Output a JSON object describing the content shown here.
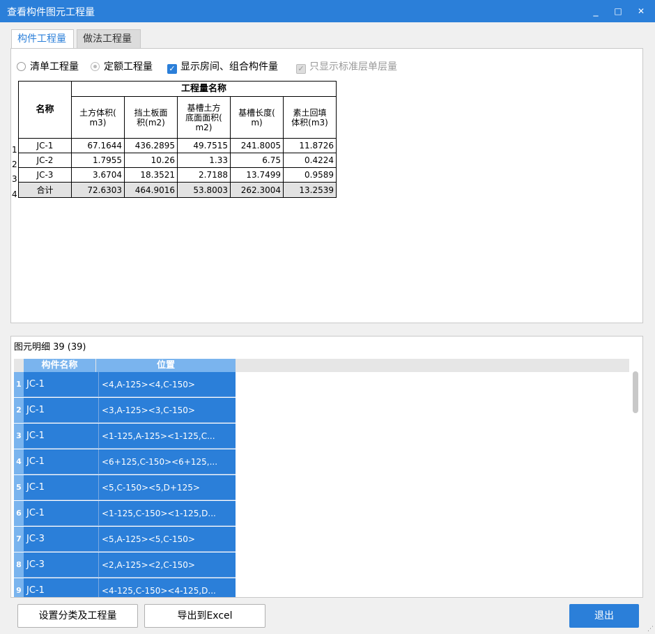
{
  "window": {
    "title": "查看构件图元工程量",
    "minimize": "_",
    "maximize": "□",
    "close": "✕"
  },
  "tabs": [
    {
      "label": "构件工程量"
    },
    {
      "label": "做法工程量"
    }
  ],
  "options": {
    "qingdan": "清单工程量",
    "dinge": "定额工程量",
    "show_rooms": "显示房间、组合构件量",
    "standard_floor": "只显示标准层单层量"
  },
  "quantity_table": {
    "group_header": "工程量名称",
    "name_header": "名称",
    "columns": [
      "土方体积(m3)",
      "挡土板面积(m2)",
      "基槽土方底面面积(m2)",
      "基槽长度(m)",
      "素土回填体积(m3)"
    ],
    "column_lines": [
      [
        "土方体积(",
        "m3)"
      ],
      [
        "挡土板面",
        "积(m2)"
      ],
      [
        "基槽土方",
        "底面面积(",
        "m2)"
      ],
      [
        "基槽长度(",
        "m)"
      ],
      [
        "素土回填",
        "体积(m3)"
      ]
    ],
    "rows": [
      {
        "num": "1",
        "name": "JC-1",
        "values": [
          "67.1644",
          "436.2895",
          "49.7515",
          "241.8005",
          "11.8726"
        ]
      },
      {
        "num": "2",
        "name": "JC-2",
        "values": [
          "1.7955",
          "10.26",
          "1.33",
          "6.75",
          "0.4224"
        ]
      },
      {
        "num": "3",
        "name": "JC-3",
        "values": [
          "3.6704",
          "18.3521",
          "2.7188",
          "13.7499",
          "0.9589"
        ]
      },
      {
        "num": "4",
        "name": "合计",
        "values": [
          "72.6303",
          "464.9016",
          "53.8003",
          "262.3004",
          "13.2539"
        ]
      }
    ]
  },
  "detail": {
    "caption": "图元明细  39 (39)",
    "headers": [
      "构件名称",
      "位置"
    ],
    "rows": [
      {
        "num": "1",
        "name": "JC-1",
        "pos": "<4,A-125><4,C-150>"
      },
      {
        "num": "2",
        "name": "JC-1",
        "pos": "<3,A-125><3,C-150>"
      },
      {
        "num": "3",
        "name": "JC-1",
        "pos": "<1-125,A-125><1-125,C..."
      },
      {
        "num": "4",
        "name": "JC-1",
        "pos": "<6+125,C-150><6+125,..."
      },
      {
        "num": "5",
        "name": "JC-1",
        "pos": "<5,C-150><5,D+125>"
      },
      {
        "num": "6",
        "name": "JC-1",
        "pos": "<1-125,C-150><1-125,D..."
      },
      {
        "num": "7",
        "name": "JC-3",
        "pos": "<5,A-125><5,C-150>"
      },
      {
        "num": "8",
        "name": "JC-3",
        "pos": "<2,A-125><2,C-150>"
      },
      {
        "num": "9",
        "name": "JC-1",
        "pos": "<4-125,C-150><4-125,D..."
      }
    ]
  },
  "buttons": {
    "classify": "设置分类及工程量",
    "export": "导出到Excel",
    "exit": "退出"
  },
  "colors": {
    "accent": "#2b7fd9",
    "header_light": "#7ab4ee"
  }
}
